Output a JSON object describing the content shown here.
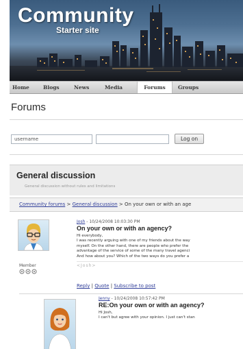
{
  "site": {
    "title": "Community",
    "subtitle": "Starter site"
  },
  "nav": {
    "items": [
      {
        "label": "Home"
      },
      {
        "label": "Blogs"
      },
      {
        "label": "News"
      },
      {
        "label": "Media"
      },
      {
        "label": "Forums"
      },
      {
        "label": "Groups"
      }
    ],
    "active": "Forums"
  },
  "page": {
    "title": "Forums"
  },
  "login": {
    "username_value": "username",
    "password_value": "",
    "button_label": "Log on"
  },
  "forum": {
    "title": "General discussion",
    "description": "General discussion without rules and limitations"
  },
  "breadcrumb": {
    "root": "Community forums",
    "sep1": " > ",
    "forum": "General discussion",
    "sep2": " > ",
    "current": "On your own or with an age"
  },
  "posts": [
    {
      "author": "Josh",
      "date": " - 10/24/2008 10:03:30 PM",
      "title": "On your own or with an agency?",
      "lines": [
        "Hi everybody,",
        "I was recently arguing with one of my friends about the way",
        "myself. On the other hand, there are people who prefer the",
        "advantage of the service of some of the many travel agenci",
        "And how about you? Which of the two ways do you prefer a"
      ],
      "signature": "<Josh>",
      "rank": "Member",
      "actions": {
        "reply": "Reply",
        "sep": " | ",
        "quote": "Quote",
        "subscribe": "Subscribe to post"
      }
    },
    {
      "author": "Jenny",
      "date": " - 10/24/2008 10:57:42 PM",
      "title": "RE:On your own or with an agency?",
      "lines": [
        "Hi Josh,",
        "I can't but agree with your opinion. I just can't stan"
      ]
    }
  ],
  "colors": {
    "link": "#2f3d99",
    "nav_bg": "#d4d4d4",
    "header_bg": "#ececec"
  }
}
